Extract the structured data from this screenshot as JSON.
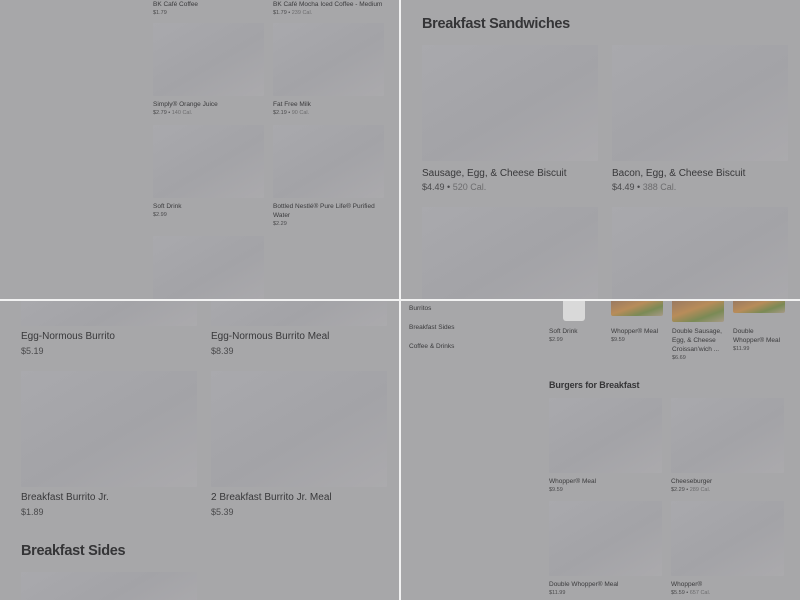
{
  "top_left": {
    "partial_items": [
      {
        "name": "BK Café Coffee",
        "price": "$1.79",
        "cal": ""
      },
      {
        "name": "BK Café Mocha Iced Coffee - Medium",
        "price": "$1.79",
        "cal": "239 Cal."
      }
    ],
    "items": [
      {
        "name": "Simply® Orange Juice",
        "price": "$2.79",
        "cal": "140 Cal."
      },
      {
        "name": "Fat Free Milk",
        "price": "$2.19",
        "cal": "90 Cal."
      },
      {
        "name": "Soft Drink",
        "price": "$2.99",
        "cal": ""
      },
      {
        "name": "Bottled Nestlé® Pure Life® Purified Water",
        "price": "$2.29",
        "cal": ""
      }
    ]
  },
  "top_right": {
    "heading": "Breakfast Sandwiches",
    "items": [
      {
        "name": "Sausage, Egg, & Cheese Biscuit",
        "price": "$4.49",
        "cal": "520 Cal."
      },
      {
        "name": "Bacon, Egg, & Cheese Biscuit",
        "price": "$4.49",
        "cal": "388 Cal."
      }
    ]
  },
  "bottom_left": {
    "items": [
      {
        "name": "Egg-Normous Burrito",
        "price": "$5.19"
      },
      {
        "name": "Egg-Normous Burrito Meal",
        "price": "$8.39"
      },
      {
        "name": "Breakfast Burrito Jr.",
        "price": "$1.89"
      },
      {
        "name": "2 Breakfast Burrito Jr. Meal",
        "price": "$5.39"
      }
    ],
    "heading": "Breakfast Sides"
  },
  "bottom_right": {
    "sidebar": [
      "Burritos",
      "Breakfast Sides",
      "Coffee & Drinks"
    ],
    "featured": [
      {
        "name": "Soft Drink",
        "price": "$2.99",
        "cal": ""
      },
      {
        "name": "Whopper® Meal",
        "price": "$9.59",
        "cal": ""
      },
      {
        "name": "Double Sausage, Egg, & Cheese Croissan'wich ...",
        "price": "$6.69",
        "cal": ""
      },
      {
        "name": "Double Whopper® Meal",
        "price": "$11.99",
        "cal": ""
      }
    ],
    "heading": "Burgers for Breakfast",
    "items": [
      {
        "name": "Whopper® Meal",
        "price": "$9.59",
        "cal": ""
      },
      {
        "name": "Cheeseburger",
        "price": "$2.29",
        "cal": "289 Cal."
      },
      {
        "name": "Double Whopper® Meal",
        "price": "$11.99",
        "cal": ""
      },
      {
        "name": "Whopper®",
        "price": "$5.59",
        "cal": "657 Cal."
      }
    ]
  }
}
